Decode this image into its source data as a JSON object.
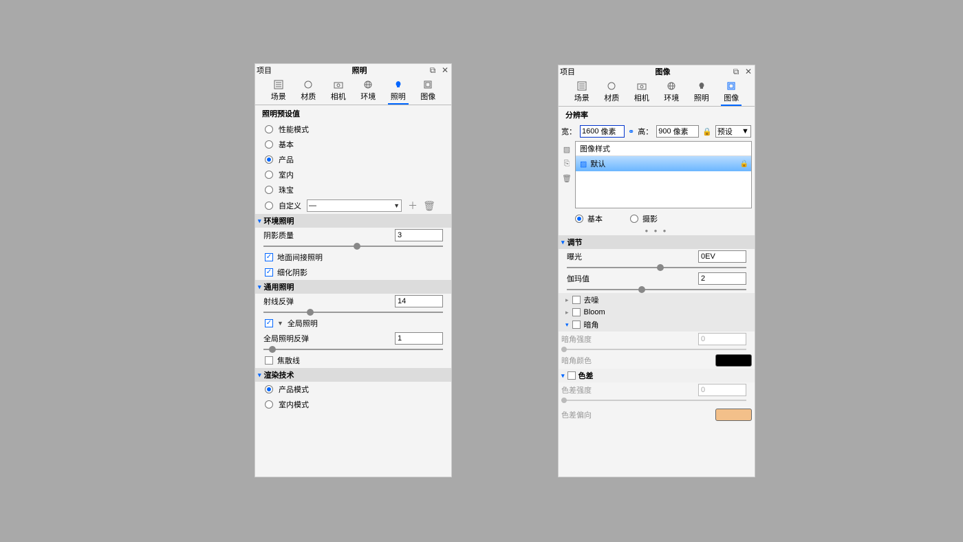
{
  "panelLeft": {
    "titleLeft": "项目",
    "titleCenter": "照明",
    "tabs": [
      {
        "label": "场景",
        "icon": "scene"
      },
      {
        "label": "材质",
        "icon": "material"
      },
      {
        "label": "相机",
        "icon": "camera"
      },
      {
        "label": "环境",
        "icon": "environment"
      },
      {
        "label": "照明",
        "icon": "lighting"
      },
      {
        "label": "图像",
        "icon": "image"
      }
    ],
    "presetHeading": "照明预设值",
    "presets": [
      {
        "label": "性能模式",
        "checked": false
      },
      {
        "label": "基本",
        "checked": false
      },
      {
        "label": "产品",
        "checked": true
      },
      {
        "label": "室内",
        "checked": false
      },
      {
        "label": "珠宝",
        "checked": false
      }
    ],
    "customLabel": "自定义",
    "customSelected": "—",
    "envSection": "环境照明",
    "shadowQuality": {
      "label": "阴影质量",
      "value": "3",
      "pos": 50
    },
    "checks1": [
      {
        "label": "地面间接照明",
        "checked": true
      },
      {
        "label": "细化阴影",
        "checked": true
      }
    ],
    "genSection": "通用照明",
    "rayBounce": {
      "label": "射线反弹",
      "value": "14",
      "pos": 24
    },
    "globalIllum": {
      "label": "全局照明",
      "checked": true
    },
    "giBounce": {
      "label": "全局照明反弹",
      "value": "1",
      "pos": 3
    },
    "caustics": {
      "label": "焦散线",
      "checked": false
    },
    "renderSection": "渲染技术",
    "renderModes": [
      {
        "label": "产品模式",
        "checked": true
      },
      {
        "label": "室内模式",
        "checked": false
      }
    ]
  },
  "panelRight": {
    "titleLeft": "项目",
    "titleCenter": "图像",
    "tabs": [
      {
        "label": "场景"
      },
      {
        "label": "材质"
      },
      {
        "label": "相机"
      },
      {
        "label": "环境"
      },
      {
        "label": "照明"
      },
      {
        "label": "图像"
      }
    ],
    "resHeading": "分辨率",
    "widthLabel": "宽：",
    "widthValue": "1600",
    "pxUnit": "像素",
    "heightLabel": "高：",
    "heightValue": "900",
    "presetLabel": "预设",
    "styleHeader": "图像样式",
    "styleItem": "默认",
    "modeBasic": "基本",
    "modePhoto": "摄影",
    "adjustSection": "调节",
    "exposure": {
      "label": "曝光",
      "value": "0EV",
      "pos": 50
    },
    "gamma": {
      "label": "伽玛值",
      "value": "2",
      "pos": 40
    },
    "fxRows": [
      {
        "label": "去噪",
        "chev": "right"
      },
      {
        "label": "Bloom",
        "chev": "right"
      },
      {
        "label": "暗角",
        "chev": "down"
      }
    ],
    "vignetteStrength": {
      "label": "暗角强度",
      "value": "0"
    },
    "vignetteColor": "暗角颜色",
    "chromAbSection": "色差",
    "chromAbStrength": {
      "label": "色差强度",
      "value": "0"
    },
    "chromAbBias": "色差偏向"
  }
}
